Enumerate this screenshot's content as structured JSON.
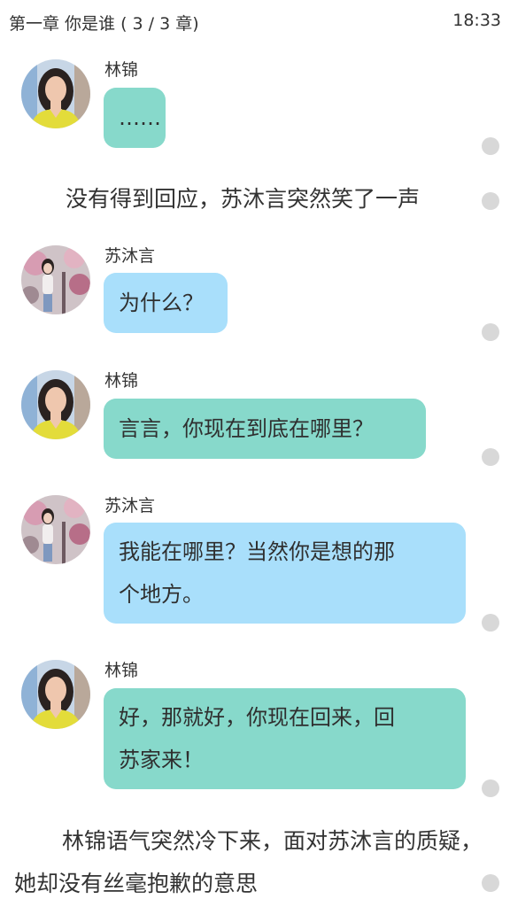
{
  "status_bar": {
    "chapter_title": "第一章 你是谁 ( 3 / 3 章)",
    "time": "18:33"
  },
  "messages": [
    {
      "type": "chat",
      "sender": "林锦",
      "text": "……",
      "bubble_color": "#87d9cb"
    },
    {
      "type": "narration",
      "text": "没有得到回应，苏沐言突然笑了一声"
    },
    {
      "type": "chat",
      "sender": "苏沐言",
      "text": "为什么？",
      "bubble_color": "#a9dffb"
    },
    {
      "type": "chat",
      "sender": "林锦",
      "text": "言言，你现在到底在哪里？",
      "bubble_color": "#87d9cb"
    },
    {
      "type": "chat",
      "sender": "苏沐言",
      "lines": [
        "我能在哪里？当然你是想的那",
        "个地方。"
      ],
      "bubble_color": "#a9dffb"
    },
    {
      "type": "chat",
      "sender": "林锦",
      "lines": [
        "好，那就好，你现在回来，回",
        "苏家来！"
      ],
      "bubble_color": "#87d9cb"
    },
    {
      "type": "narration",
      "text": "林锦语气突然冷下来，面对苏沐言的质疑，她却没有丝毫抱歉的意思"
    }
  ]
}
